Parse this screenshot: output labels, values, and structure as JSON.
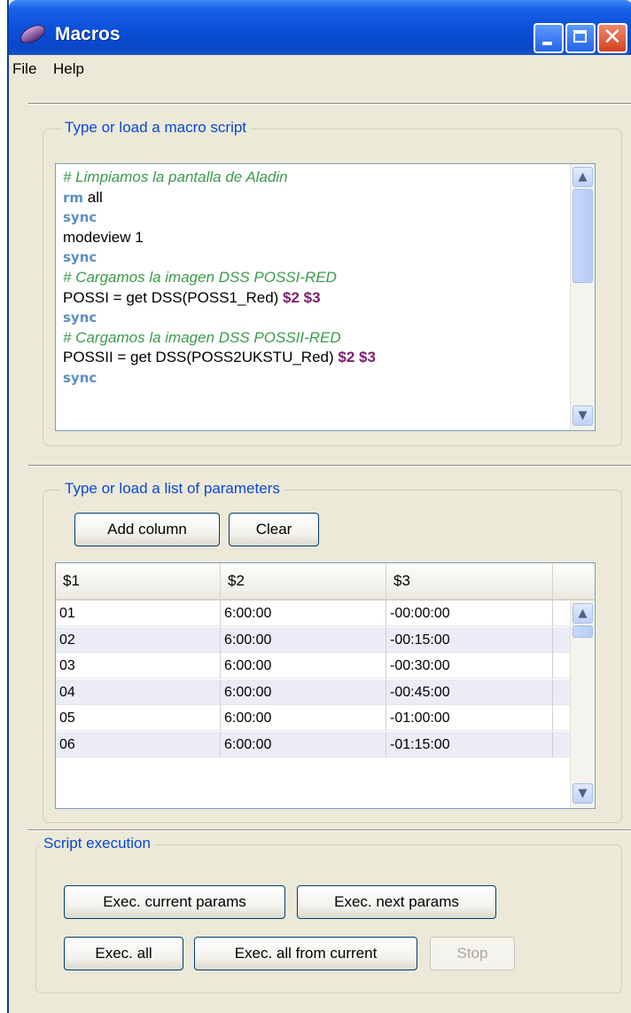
{
  "window": {
    "title": "Macros",
    "minimize_icon": "minimize-icon",
    "maximize_icon": "maximize-icon",
    "close_icon": "close-icon",
    "close_glyph": "✕"
  },
  "menu": {
    "file": "File",
    "help": "Help"
  },
  "script_panel": {
    "title": "Type or load a macro script",
    "lines": [
      [
        {
          "t": "comment",
          "v": "# Limpiamos la pantalla de Aladin"
        }
      ],
      [
        {
          "t": "kw",
          "v": "rm"
        },
        {
          "t": "plain",
          "v": " all"
        }
      ],
      [
        {
          "t": "kw",
          "v": "sync"
        }
      ],
      [
        {
          "t": "plain",
          "v": "modeview 1"
        }
      ],
      [
        {
          "t": "kw",
          "v": "sync"
        }
      ],
      [
        {
          "t": "comment",
          "v": "# Cargamos la imagen DSS POSSI-RED"
        }
      ],
      [
        {
          "t": "plain",
          "v": "POSSI = get DSS(POSS1_Red) "
        },
        {
          "t": "param",
          "v": "$2 $3"
        }
      ],
      [
        {
          "t": "kw",
          "v": "sync"
        }
      ],
      [
        {
          "t": "comment",
          "v": "# Cargamos la imagen DSS POSSII-RED"
        }
      ],
      [
        {
          "t": "plain",
          "v": "POSSII = get DSS(POSS2UKSTU_Red) "
        },
        {
          "t": "param",
          "v": "$2 $3"
        }
      ],
      [
        {
          "t": "kw",
          "v": "sync"
        }
      ]
    ]
  },
  "params_panel": {
    "title": "Type or load a list of parameters",
    "add_column_label": "Add column",
    "clear_label": "Clear",
    "columns": [
      "$1",
      "$2",
      "$3"
    ],
    "rows": [
      [
        "01",
        "6:00:00",
        "-00:00:00"
      ],
      [
        "02",
        "6:00:00",
        "-00:15:00"
      ],
      [
        "03",
        "6:00:00",
        "-00:30:00"
      ],
      [
        "04",
        "6:00:00",
        "-00:45:00"
      ],
      [
        "05",
        "6:00:00",
        "-01:00:00"
      ],
      [
        "06",
        "6:00:00",
        "-01:15:00"
      ]
    ]
  },
  "execution_panel": {
    "title": "Script execution",
    "exec_current_label": "Exec. current params",
    "exec_next_label": "Exec. next params",
    "exec_all_label": "Exec. all",
    "exec_all_from_current_label": "Exec. all from current",
    "stop_label": "Stop"
  },
  "icons": {
    "scroll_up": "▲",
    "scroll_down": "▼"
  },
  "colors": {
    "titlebar": "#0b4fd9",
    "group_title": "#0a47d1",
    "comment": "#3c9a4c",
    "keyword": "#5a8fc4",
    "param": "#7b1f6e"
  }
}
